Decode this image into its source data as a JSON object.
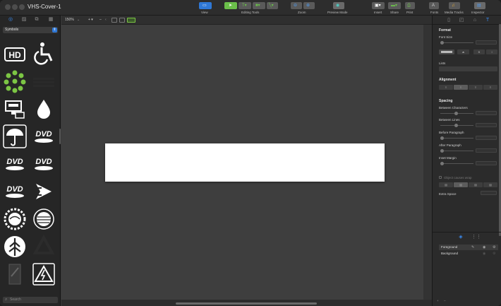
{
  "window": {
    "title": "VHS-Cover-1"
  },
  "toolbar": {
    "view_label": "View",
    "editing_tools_label": "Editing Tools",
    "zoom_label": "Zoom",
    "preview_label": "Preview Mode",
    "insert_label": "Insert",
    "share_label": "Share",
    "print_label": "Print",
    "fonts_label": "Fonts",
    "fonts_glyph": "A",
    "media_label": "Media Tracks",
    "inspector_label": "Inspector"
  },
  "left_panel": {
    "category": "Symbols",
    "search_placeholder": "Search",
    "symbols": [
      "hd",
      "wheelchair",
      "dots",
      "vhs-logo",
      "vcr",
      "water-drop",
      "umbrella",
      "dvd",
      "dvd-video",
      "dvd-rom",
      "dvd-audio",
      "fast-forward",
      "globe-1",
      "globe-2",
      "tree",
      "recycle",
      "warning-sign",
      "warning-high-voltage"
    ]
  },
  "canvas_bar": {
    "zoom": "150%"
  },
  "inspector": {
    "format_title": "Format",
    "font_size_label": "Font Size",
    "lists_label": "Lists",
    "alignment_title": "Alignment",
    "spacing_title": "Spacing",
    "between_chars_label": "Between Characters",
    "between_lines_label": "Between Lines",
    "before_paragraph_label": "Before Paragraph",
    "after_paragraph_label": "After Paragraph",
    "inset_margin_label": "Inset Margin",
    "object_wrap_label": "Object causes wrap",
    "extra_space_label": "Extra Space",
    "layers": [
      {
        "name": "Foreground"
      },
      {
        "name": "Background"
      }
    ]
  }
}
